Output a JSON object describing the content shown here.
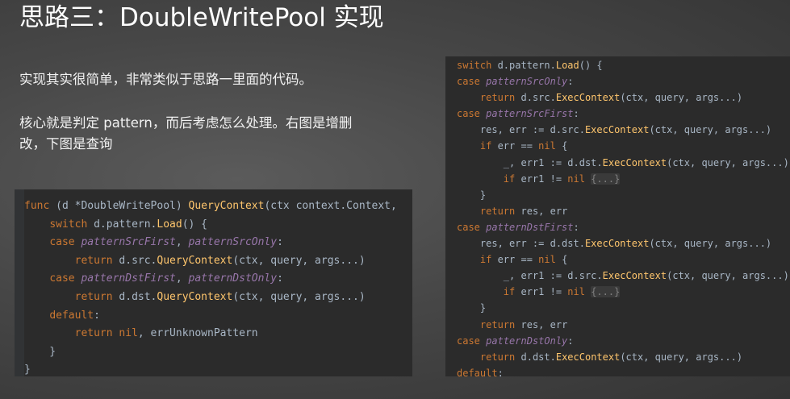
{
  "title": "思路三：DoubleWritePool 实现",
  "paragraph1": "实现其实很简单，非常类似于思路一里面的代码。",
  "paragraph2": "核心就是判定 pattern，而后考虑怎么处理。右图是增删改，下图是查询",
  "code_left": [
    [
      [
        "kw",
        "func"
      ],
      [
        "t",
        " (d *"
      ],
      [
        "t",
        "DoubleWritePool"
      ],
      [
        "t",
        ") "
      ],
      [
        "fn",
        "QueryContext"
      ],
      [
        "t",
        "(ctx context.Context,"
      ]
    ],
    [
      [
        "t",
        "    "
      ],
      [
        "kw",
        "switch"
      ],
      [
        "t",
        " d.pattern."
      ],
      [
        "fn",
        "Load"
      ],
      [
        "t",
        "() {"
      ]
    ],
    [
      [
        "t",
        "    "
      ],
      [
        "kw",
        "case"
      ],
      [
        "t",
        " "
      ],
      [
        "cn",
        "patternSrcFirst"
      ],
      [
        "t",
        ", "
      ],
      [
        "cn",
        "patternSrcOnly"
      ],
      [
        "t",
        ":"
      ]
    ],
    [
      [
        "t",
        "        "
      ],
      [
        "kw",
        "return"
      ],
      [
        "t",
        " d.src."
      ],
      [
        "fn",
        "QueryContext"
      ],
      [
        "t",
        "(ctx, query, args...)"
      ]
    ],
    [
      [
        "t",
        "    "
      ],
      [
        "kw",
        "case"
      ],
      [
        "t",
        " "
      ],
      [
        "cn",
        "patternDstFirst"
      ],
      [
        "t",
        ", "
      ],
      [
        "cn",
        "patternDstOnly"
      ],
      [
        "t",
        ":"
      ]
    ],
    [
      [
        "t",
        "        "
      ],
      [
        "kw",
        "return"
      ],
      [
        "t",
        " d.dst."
      ],
      [
        "fn",
        "QueryContext"
      ],
      [
        "t",
        "(ctx, query, args...)"
      ]
    ],
    [
      [
        "t",
        "    "
      ],
      [
        "kw",
        "default"
      ],
      [
        "t",
        ":"
      ]
    ],
    [
      [
        "t",
        "        "
      ],
      [
        "kw",
        "return"
      ],
      [
        "t",
        " "
      ],
      [
        "kw",
        "nil"
      ],
      [
        "t",
        ", errUnknownPattern"
      ]
    ],
    [
      [
        "t",
        "    }"
      ]
    ],
    [
      [
        "t",
        "}"
      ]
    ]
  ],
  "code_right": [
    [
      [
        "kw",
        "switch"
      ],
      [
        "t",
        " d.pattern."
      ],
      [
        "fn",
        "Load"
      ],
      [
        "t",
        "() {"
      ]
    ],
    [
      [
        "kw",
        "case"
      ],
      [
        "t",
        " "
      ],
      [
        "cn",
        "patternSrcOnly"
      ],
      [
        "t",
        ":"
      ]
    ],
    [
      [
        "t",
        "    "
      ],
      [
        "kw",
        "return"
      ],
      [
        "t",
        " d.src."
      ],
      [
        "fn",
        "ExecContext"
      ],
      [
        "t",
        "(ctx, query, args...)"
      ]
    ],
    [
      [
        "kw",
        "case"
      ],
      [
        "t",
        " "
      ],
      [
        "cn",
        "patternSrcFirst"
      ],
      [
        "t",
        ":"
      ]
    ],
    [
      [
        "t",
        "    res, err := d.src."
      ],
      [
        "fn",
        "ExecContext"
      ],
      [
        "t",
        "(ctx, query, args...)"
      ]
    ],
    [
      [
        "t",
        "    "
      ],
      [
        "kw",
        "if"
      ],
      [
        "t",
        " err == "
      ],
      [
        "kw",
        "nil"
      ],
      [
        "t",
        " {"
      ]
    ],
    [
      [
        "t",
        "        _, err1 := d.dst."
      ],
      [
        "fn",
        "ExecContext"
      ],
      [
        "t",
        "(ctx, query, args...)"
      ]
    ],
    [
      [
        "t",
        "        "
      ],
      [
        "kw",
        "if"
      ],
      [
        "t",
        " err1 != "
      ],
      [
        "kw",
        "nil"
      ],
      [
        "t",
        " "
      ],
      [
        "fold",
        "{...}"
      ]
    ],
    [
      [
        "t",
        "    }"
      ]
    ],
    [
      [
        "t",
        "    "
      ],
      [
        "kw",
        "return"
      ],
      [
        "t",
        " res, err"
      ]
    ],
    [
      [
        "kw",
        "case"
      ],
      [
        "t",
        " "
      ],
      [
        "cn",
        "patternDstFirst"
      ],
      [
        "t",
        ":"
      ]
    ],
    [
      [
        "t",
        "    res, err := d.dst."
      ],
      [
        "fn",
        "ExecContext"
      ],
      [
        "t",
        "(ctx, query, args...)"
      ]
    ],
    [
      [
        "t",
        "    "
      ],
      [
        "kw",
        "if"
      ],
      [
        "t",
        " err == "
      ],
      [
        "kw",
        "nil"
      ],
      [
        "t",
        " {"
      ]
    ],
    [
      [
        "t",
        "        _, err1 := d.src."
      ],
      [
        "fn",
        "ExecContext"
      ],
      [
        "t",
        "(ctx, query, args...)"
      ]
    ],
    [
      [
        "t",
        "        "
      ],
      [
        "kw",
        "if"
      ],
      [
        "t",
        " err1 != "
      ],
      [
        "kw",
        "nil"
      ],
      [
        "t",
        " "
      ],
      [
        "fold",
        "{...}"
      ]
    ],
    [
      [
        "t",
        "    }"
      ]
    ],
    [
      [
        "t",
        "    "
      ],
      [
        "kw",
        "return"
      ],
      [
        "t",
        " res, err"
      ]
    ],
    [
      [
        "kw",
        "case"
      ],
      [
        "t",
        " "
      ],
      [
        "cn",
        "patternDstOnly"
      ],
      [
        "t",
        ":"
      ]
    ],
    [
      [
        "t",
        "    "
      ],
      [
        "kw",
        "return"
      ],
      [
        "t",
        " d.dst."
      ],
      [
        "fn",
        "ExecContext"
      ],
      [
        "t",
        "(ctx, query, args...)"
      ]
    ],
    [
      [
        "kw",
        "default"
      ],
      [
        "t",
        ":"
      ]
    ]
  ]
}
